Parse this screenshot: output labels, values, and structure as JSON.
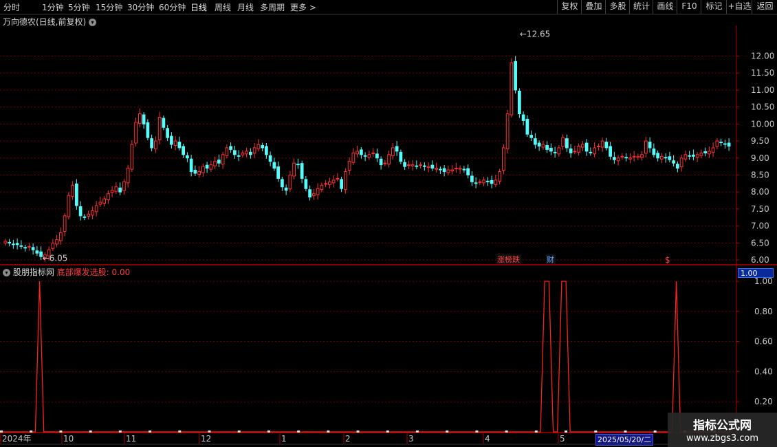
{
  "toolbar": {
    "timeframes": [
      "分时",
      "1分钟",
      "5分钟",
      "15分钟",
      "30分钟",
      "60分钟",
      "日线",
      "周线",
      "月线",
      "多周期",
      "更多 >"
    ],
    "active": "日线",
    "buttons": [
      "复权",
      "叠加",
      "多股",
      "统计",
      "画线",
      "F10",
      "标记",
      "+自选",
      "返回"
    ]
  },
  "main_panel": {
    "title": "万向德农(日线,前复权)",
    "dropdown_icon": "chevron-down-icon"
  },
  "sub_panel": {
    "indicator_name": "股朋指标网",
    "series_label": "底部爆发选股: 0.00",
    "current_value": "1.00"
  },
  "markers": {
    "zhangbang": "涨榜跌",
    "cai": "财",
    "dollar": "$"
  },
  "date_box": "2025/05/20/二",
  "watermark": {
    "line1": "指标公式网",
    "line2": "www.zbgs3.com"
  },
  "colors": {
    "up": "#ff3232",
    "down": "#54fcfc",
    "signal": "#ff2020",
    "grid": "#700000",
    "axis": "#b00000"
  },
  "chart_data": [
    {
      "type": "candlestick",
      "title": "万向德农(日线,前复权)",
      "ylim": [
        5.9,
        12.9
      ],
      "y_ticks": [
        6.0,
        6.5,
        7.0,
        7.5,
        8.0,
        8.5,
        9.0,
        9.5,
        10.0,
        10.5,
        11.0,
        11.5,
        12.0
      ],
      "y_tick_labels": [
        "6.00",
        "6.50",
        "7.00",
        "7.50",
        "8.00",
        "8.50",
        "9.00",
        "9.50",
        "10.00",
        "10.50",
        "11.00",
        "11.50",
        "12.00"
      ],
      "annotations": [
        {
          "label": "12.65",
          "value": 12.65
        },
        {
          "label": "6.05",
          "value": 6.05
        }
      ],
      "x_labels": [
        "2024年",
        "10",
        "11",
        "12",
        "1",
        "2",
        "3",
        "4",
        "5"
      ],
      "approx_closes": [
        6.55,
        6.5,
        6.45,
        6.45,
        6.4,
        6.35,
        6.4,
        6.3,
        6.2,
        6.1,
        6.15,
        6.3,
        6.5,
        6.6,
        6.8,
        7.3,
        7.9,
        8.2,
        7.6,
        7.3,
        7.25,
        7.35,
        7.45,
        7.6,
        7.7,
        7.8,
        7.95,
        8.05,
        8.15,
        8.0,
        8.3,
        8.7,
        9.4,
        10.05,
        10.3,
        10.0,
        9.6,
        9.3,
        9.5,
        10.2,
        9.9,
        9.6,
        9.4,
        9.5,
        9.3,
        9.1,
        9.0,
        8.6,
        8.55,
        8.6,
        8.75,
        8.7,
        8.8,
        8.9,
        8.85,
        9.1,
        9.3,
        9.25,
        9.1,
        9.05,
        9.15,
        9.2,
        9.1,
        9.3,
        9.4,
        9.3,
        9.1,
        8.9,
        8.7,
        8.4,
        8.15,
        8.05,
        8.5,
        8.85,
        8.8,
        8.4,
        8.1,
        7.85,
        7.95,
        8.1,
        8.2,
        8.25,
        8.3,
        8.35,
        8.4,
        8.1,
        8.6,
        8.9,
        9.15,
        9.2,
        9.1,
        9.05,
        9.1,
        9.15,
        9.0,
        8.8,
        8.85,
        9.1,
        9.3,
        9.2,
        8.9,
        8.75,
        8.8,
        8.8,
        8.75,
        8.8,
        8.75,
        8.75,
        8.7,
        8.7,
        8.65,
        8.6,
        8.65,
        8.65,
        8.7,
        8.7,
        8.65,
        8.5,
        8.3,
        8.25,
        8.3,
        8.35,
        8.3,
        8.25,
        8.35,
        8.6,
        9.3,
        10.3,
        11.8,
        11.0,
        10.3,
        10.1,
        9.7,
        9.6,
        9.4,
        9.35,
        9.4,
        9.25,
        9.2,
        9.15,
        9.3,
        9.6,
        9.3,
        9.15,
        9.2,
        9.35,
        9.4,
        9.2,
        9.15,
        9.3,
        9.35,
        9.5,
        9.3,
        9.05,
        8.95,
        9.0,
        9.05,
        9.0,
        9.0,
        9.05,
        9.05,
        9.1,
        9.5,
        9.3,
        9.1,
        9.0,
        9.05,
        9.0,
        8.95,
        8.85,
        8.7,
        9.0,
        9.1,
        9.05,
        9.05,
        9.1,
        9.15,
        9.15,
        9.2,
        9.3,
        9.5,
        9.45,
        9.4,
        9.35
      ]
    },
    {
      "type": "line",
      "series_name": "底部爆发选股",
      "ylim": [
        0,
        1.05
      ],
      "y_ticks": [
        0.2,
        0.4,
        0.6,
        0.8,
        1.0
      ],
      "y_tick_labels": [
        "0.20",
        "0.40",
        "0.60",
        "0.80",
        "1.00"
      ],
      "signals_at_bar": [
        9,
        128,
        129,
        132,
        133,
        159
      ],
      "bar_count": 173
    }
  ]
}
